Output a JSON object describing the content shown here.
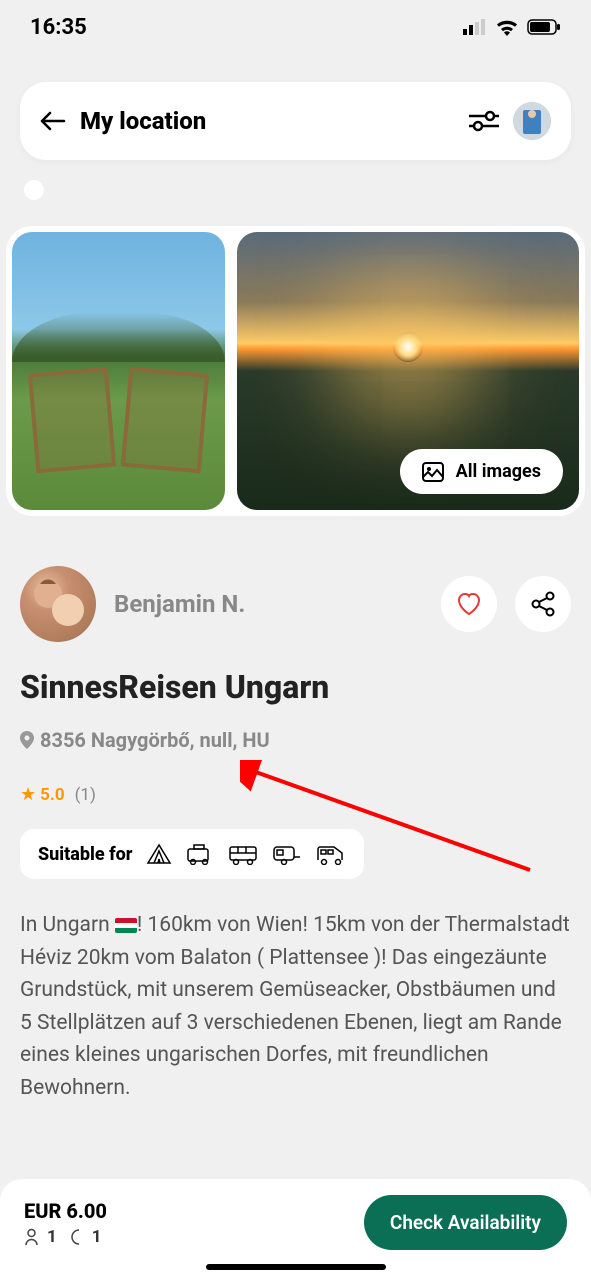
{
  "status": {
    "time": "16:35"
  },
  "header": {
    "title": "My location"
  },
  "gallery": {
    "all_images_label": "All images"
  },
  "host": {
    "name": "Benjamin N."
  },
  "listing": {
    "title": "SinnesReisen Ungarn",
    "location": "8356 Nagygörbő, null, HU",
    "rating": "5.0",
    "rating_count": "(1)",
    "suitable_label": "Suitable for",
    "description_pre": "In Ungarn ",
    "description_post": "! 160km von Wien! 15km von der Thermalstadt Héviz 20km vom Balaton ( Plattensee )! Das eingezäunte Grundstück, mit unserem Gemüseacker, Obstbäumen und 5 Stellplätzen auf 3 verschiedenen Ebenen, liegt am Rande eines kleines ungarischen Dorfes, mit freundlichen Bewohnern."
  },
  "bottom": {
    "price_currency": "EUR",
    "price_amount": "6.00",
    "persons": "1",
    "nights": "1",
    "cta": "Check Availability"
  }
}
